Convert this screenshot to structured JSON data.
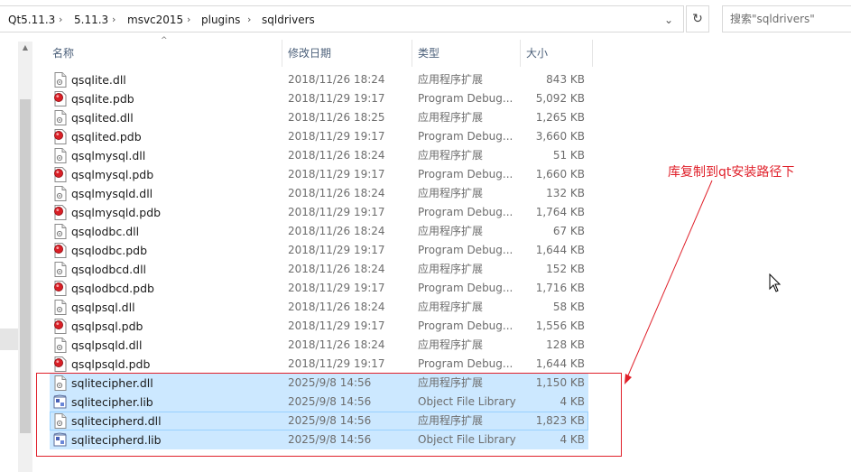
{
  "address_bar": {
    "crumbs": [
      "Qt5.11.3",
      "5.11.3",
      "msvc2015",
      "plugins",
      "sqldrivers"
    ],
    "separator": "›",
    "dropdown_glyph": "⌄",
    "refresh_glyph": "↻"
  },
  "search": {
    "placeholder": "搜索\"sqldrivers\""
  },
  "columns": {
    "name": "名称",
    "date": "修改日期",
    "type": "类型",
    "size": "大小"
  },
  "files": [
    {
      "name": "qsqlite.dll",
      "date": "2018/11/26 18:24",
      "type": "应用程序扩展",
      "size": "843 KB",
      "icon": "dll-icon",
      "selected": false
    },
    {
      "name": "qsqlite.pdb",
      "date": "2018/11/29 19:17",
      "type": "Program Debug...",
      "size": "5,092 KB",
      "icon": "pdb-icon",
      "selected": false
    },
    {
      "name": "qsqlited.dll",
      "date": "2018/11/26 18:25",
      "type": "应用程序扩展",
      "size": "1,265 KB",
      "icon": "dll-icon",
      "selected": false
    },
    {
      "name": "qsqlited.pdb",
      "date": "2018/11/29 19:17",
      "type": "Program Debug...",
      "size": "3,660 KB",
      "icon": "pdb-icon",
      "selected": false
    },
    {
      "name": "qsqlmysql.dll",
      "date": "2018/11/26 18:24",
      "type": "应用程序扩展",
      "size": "51 KB",
      "icon": "dll-icon",
      "selected": false
    },
    {
      "name": "qsqlmysql.pdb",
      "date": "2018/11/29 19:17",
      "type": "Program Debug...",
      "size": "1,660 KB",
      "icon": "pdb-icon",
      "selected": false
    },
    {
      "name": "qsqlmysqld.dll",
      "date": "2018/11/26 18:24",
      "type": "应用程序扩展",
      "size": "132 KB",
      "icon": "dll-icon",
      "selected": false
    },
    {
      "name": "qsqlmysqld.pdb",
      "date": "2018/11/29 19:17",
      "type": "Program Debug...",
      "size": "1,764 KB",
      "icon": "pdb-icon",
      "selected": false
    },
    {
      "name": "qsqlodbc.dll",
      "date": "2018/11/26 18:24",
      "type": "应用程序扩展",
      "size": "67 KB",
      "icon": "dll-icon",
      "selected": false
    },
    {
      "name": "qsqlodbc.pdb",
      "date": "2018/11/29 19:17",
      "type": "Program Debug...",
      "size": "1,644 KB",
      "icon": "pdb-icon",
      "selected": false
    },
    {
      "name": "qsqlodbcd.dll",
      "date": "2018/11/26 18:24",
      "type": "应用程序扩展",
      "size": "152 KB",
      "icon": "dll-icon",
      "selected": false
    },
    {
      "name": "qsqlodbcd.pdb",
      "date": "2018/11/29 19:17",
      "type": "Program Debug...",
      "size": "1,716 KB",
      "icon": "pdb-icon",
      "selected": false
    },
    {
      "name": "qsqlpsql.dll",
      "date": "2018/11/26 18:24",
      "type": "应用程序扩展",
      "size": "58 KB",
      "icon": "dll-icon",
      "selected": false
    },
    {
      "name": "qsqlpsql.pdb",
      "date": "2018/11/29 19:17",
      "type": "Program Debug...",
      "size": "1,556 KB",
      "icon": "pdb-icon",
      "selected": false
    },
    {
      "name": "qsqlpsqld.dll",
      "date": "2018/11/26 18:24",
      "type": "应用程序扩展",
      "size": "128 KB",
      "icon": "dll-icon",
      "selected": false
    },
    {
      "name": "qsqlpsqld.pdb",
      "date": "2018/11/29 19:17",
      "type": "Program Debug...",
      "size": "1,644 KB",
      "icon": "pdb-icon",
      "selected": false
    },
    {
      "name": "sqlitecipher.dll",
      "date": "2025/9/8 14:56",
      "type": "应用程序扩展",
      "size": "1,150 KB",
      "icon": "dll-icon",
      "selected": true
    },
    {
      "name": "sqlitecipher.lib",
      "date": "2025/9/8 14:56",
      "type": "Object File Library",
      "size": "4 KB",
      "icon": "lib-icon",
      "selected": true
    },
    {
      "name": "sqlitecipherd.dll",
      "date": "2025/9/8 14:56",
      "type": "应用程序扩展",
      "size": "1,823 KB",
      "icon": "dll-icon",
      "selected": true
    },
    {
      "name": "sqlitecipherd.lib",
      "date": "2025/9/8 14:56",
      "type": "Object File Library",
      "size": "4 KB",
      "icon": "lib-icon",
      "selected": true
    }
  ],
  "annotation": {
    "text": "库复制到qt安装路径下",
    "color": "#e0202a"
  },
  "colors": {
    "selection": "#cce8ff",
    "header_text": "#4c607a",
    "secondary_text": "#6d6d6d"
  }
}
